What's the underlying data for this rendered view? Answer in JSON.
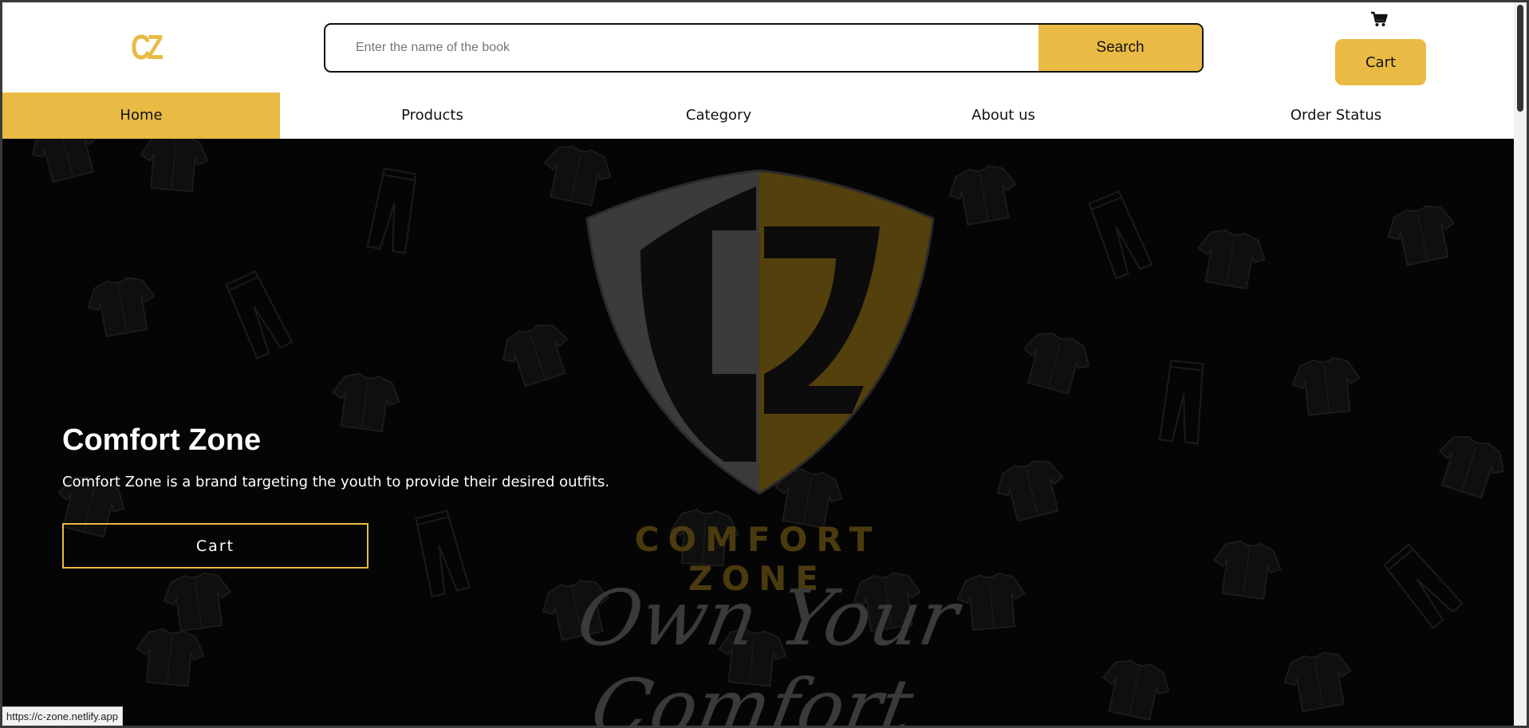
{
  "brand": {
    "logo_text": "CZ",
    "emblem_wordmark": "COMFORT ZONE",
    "slogan": "Own Your Comfort"
  },
  "search": {
    "placeholder": "Enter the name of the book",
    "value": "",
    "button_label": "Search"
  },
  "header": {
    "cart_icon": "shopping-cart-icon",
    "cart_label": "Cart"
  },
  "nav": {
    "items": [
      {
        "label": "Home",
        "active": true
      },
      {
        "label": "Products",
        "active": false
      },
      {
        "label": "Category",
        "active": false
      },
      {
        "label": "About us",
        "active": false
      },
      {
        "label": "Order Status",
        "active": false
      }
    ]
  },
  "hero": {
    "title": "Comfort Zone",
    "text": "Comfort Zone is a brand targeting the youth to provide their desired outfits.",
    "button_label": "Cart"
  },
  "status_bar": {
    "url": "https://c-zone.netlify.app"
  },
  "colors": {
    "accent": "#e9bb45",
    "hero_background": "#050505"
  }
}
